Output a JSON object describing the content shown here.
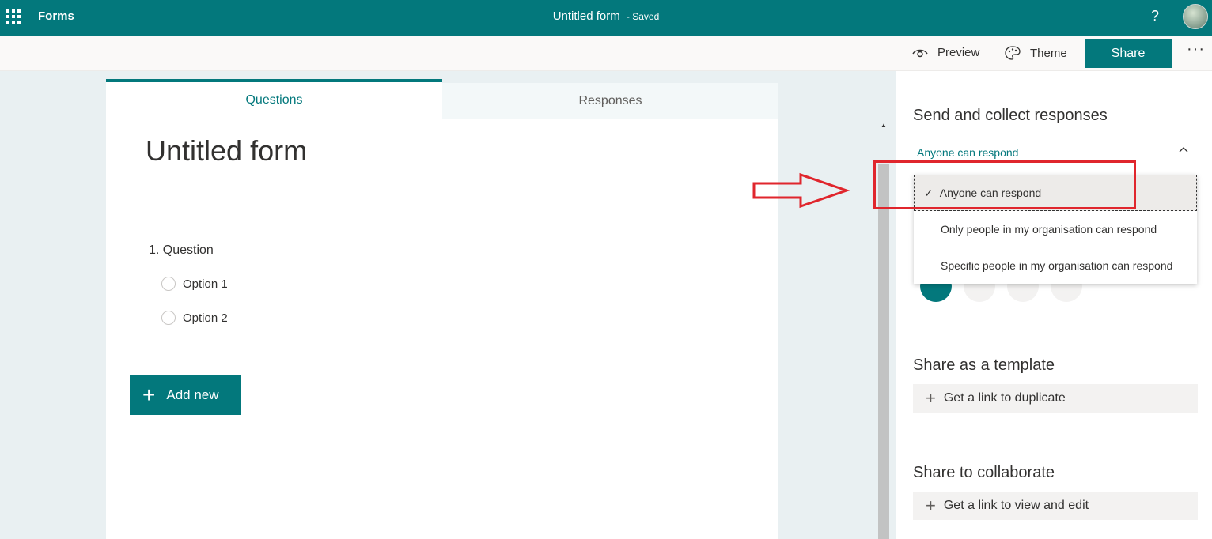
{
  "topbar": {
    "app_name": "Forms",
    "form_title": "Untitled form",
    "save_status": "Saved",
    "help_label": "?"
  },
  "toolbar": {
    "preview_label": "Preview",
    "theme_label": "Theme",
    "share_label": "Share",
    "more_label": "···"
  },
  "tabs": [
    {
      "label": "Questions",
      "active": true
    },
    {
      "label": "Responses",
      "active": false
    }
  ],
  "form": {
    "title": "Untitled form",
    "question_label": "1. Question",
    "options": [
      "Option 1",
      "Option 2"
    ],
    "add_new_label": "Add new"
  },
  "panel": {
    "heading": "Send and collect responses",
    "permission_selected": "Anyone can respond",
    "permission_options": [
      "Anyone can respond",
      "Only people in my organisation can respond",
      "Specific people in my organisation can respond"
    ],
    "share_icons": [
      "link-icon",
      "qr-code-icon",
      "embed-icon",
      "email-icon"
    ],
    "template_heading": "Share as a template",
    "template_link_label": "Get a link to duplicate",
    "collab_heading": "Share to collaborate",
    "collab_link_label": "Get a link to view and edit"
  },
  "colors": {
    "brand": "#03787c",
    "annotation": "#e0262d"
  }
}
